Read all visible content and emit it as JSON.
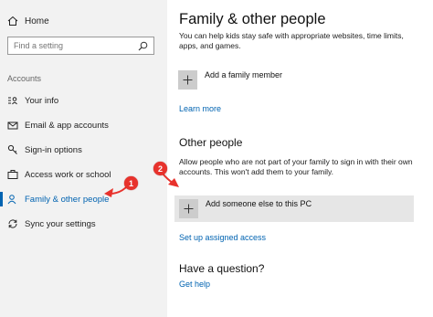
{
  "sidebar": {
    "home_label": "Home",
    "search_placeholder": "Find a setting",
    "section_label": "Accounts",
    "items": [
      {
        "label": "Your info",
        "icon": "person-card-icon"
      },
      {
        "label": "Email & app accounts",
        "icon": "mail-icon"
      },
      {
        "label": "Sign-in options",
        "icon": "key-icon"
      },
      {
        "label": "Access work or school",
        "icon": "briefcase-icon"
      },
      {
        "label": "Family & other people",
        "icon": "person-add-icon",
        "active": true
      },
      {
        "label": "Sync your settings",
        "icon": "sync-icon"
      }
    ]
  },
  "main": {
    "title": "Family & other people",
    "family_description": "You can help kids stay safe with appropriate websites, time limits, apps, and games.",
    "add_family_member": "Add a family member",
    "learn_more": "Learn more",
    "other_people_heading": "Other people",
    "other_people_description": "Allow people who are not part of your family to sign in with their own accounts. This won't add them to your family.",
    "add_someone_else": "Add someone else to this PC",
    "set_up_assigned_access": "Set up assigned access",
    "question_heading": "Have a question?",
    "get_help": "Get help"
  },
  "callouts": {
    "one": "1",
    "two": "2"
  },
  "colors": {
    "accent": "#0063b1",
    "callout": "#e8322c",
    "sidebar_bg": "#f2f2f2"
  }
}
